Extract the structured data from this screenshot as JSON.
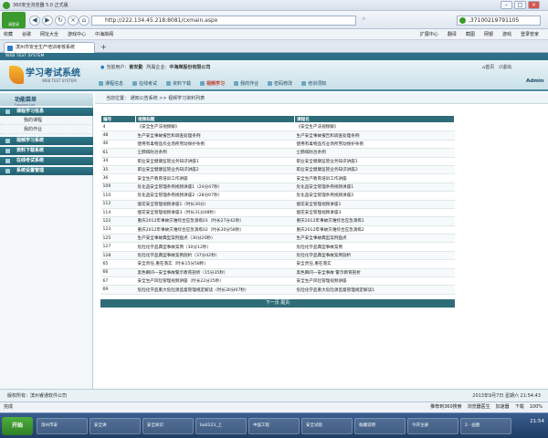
{
  "browser": {
    "window_title": "360安全浏览器 5.0 正式版",
    "logo_label": "请登录",
    "address": "http://222.134.45.218:8081/cxmain.aspx",
    "search_value": ",37100219791105",
    "favorites": [
      "收藏",
      "谷歌",
      "网址大全",
      "游戏中心",
      "中海岸阁"
    ],
    "right_tools": [
      "扩展中心",
      "翻译",
      "截图",
      "网银",
      "游戏",
      "登录管家"
    ],
    "tab_label": "滨州市安全生产培训考核系统",
    "status_left": "完成",
    "status_right": [
      "推荐到360搜索",
      "浏览器医生",
      "加速器",
      "下载",
      "100%"
    ]
  },
  "app": {
    "topbar_text": "WEB TEST SYSTEM",
    "brand_title": "学习考试系统",
    "brand_sub": "WEB TEST SYSTEM",
    "current_user_label": "当前用户：",
    "current_user": "索安勤",
    "company_label": "所属企业：",
    "company": "中海岸股份有限公司",
    "top_links": [
      "首页",
      "退出"
    ],
    "admin": "Admin",
    "menu": [
      "课程信息",
      "在线考试",
      "资料下载",
      "视频学习",
      "我的作业",
      "密码修改",
      "培训须知"
    ],
    "active_menu_index": 3
  },
  "sidebar": {
    "title": "功能菜单",
    "subtitle": "Function List",
    "groups": [
      {
        "label": "课程学习信息",
        "items": [
          "我的课程",
          "我的作业"
        ]
      },
      {
        "label": "视频学习系统",
        "items": []
      },
      {
        "label": "资料下载系统",
        "items": []
      },
      {
        "label": "在线考试系统",
        "items": []
      },
      {
        "label": "系统设置管理",
        "items": []
      }
    ]
  },
  "breadcrumb": "当前位置： 通知公告系统 >> 视频学习资料列表",
  "table": {
    "headers": [
      "编号",
      "视频标题",
      "课程名"
    ],
    "rows": [
      [
        "4",
        "《安全生产法视频解》",
        "《安全生产法视频解》"
      ],
      [
        "48",
        "生产安全事故报告和调查处理条例",
        "生产安全事故报告和调查处理条例"
      ],
      [
        "46",
        "使用有毒物品作业场所劳动保护条例",
        "使用有毒物品作业场所劳动保护条例"
      ],
      [
        "61",
        "尘肺病防治条例",
        "尘肺病防治条例"
      ],
      [
        "34",
        "职业安全健康监管业务知识讲座1",
        "职业安全健康监管业务知识讲座1"
      ],
      [
        "35",
        "职业安全健康监管业务知识讲座2",
        "职业安全健康监管业务知识讲座2"
      ],
      [
        "36",
        "安全生产教育培训工作讲座",
        "安全生产教育培训工作讲座"
      ],
      [
        "109",
        "危化品安全管理条例视频讲座1（24分47秒）",
        "危化品安全管理条例视频讲座1"
      ],
      [
        "110",
        "危化品安全管理条例视频讲座2（28分07秒）",
        "危化品安全管理条例视频讲座2"
      ],
      [
        "112",
        "烟花安全管理视频讲座1（时长30分）",
        "烟花安全管理视频讲座1"
      ],
      [
        "114",
        "烟花安全管理视频讲座3（时长31分08秒）",
        "烟花安全管理视频讲座3"
      ],
      [
        "122",
        "重庆2012年事故灾难综合应急演练01（时长27分42秒）",
        "重庆2012年事故灾难综合应急演练1"
      ],
      [
        "123",
        "重庆2012年事故灾难综合应急演练02（时长30分58秒）",
        "重庆2012年事故灾难综合应急演练2"
      ],
      [
        "125",
        "生产安全事故典型案例盘点（30分20秒）",
        "生产安全事故典型案例盘点"
      ],
      [
        "127",
        "危险化学品典型事故案例（30分12秒）",
        "危险化学品典型事故案例"
      ],
      [
        "128",
        "危险化学品典型事故案例剖析（37分42秒）",
        "危险化学品典型事故案例剖析"
      ],
      [
        "65",
        "安全责任,重在落实（时长15分58秒）",
        "安全责任,重在落实"
      ],
      [
        "66",
        "黑色瞬间一安全事故警示教育剖析（15分35秒）",
        "黑色瞬间一安全事故 警示教育剖析"
      ],
      [
        "67",
        "安全生产风险管理视频讲座（时长22分25秒）",
        "安全生产风险管理视频讲座"
      ],
      [
        "69",
        "危险化学品重大危险源监督管理规定解读（时长30分07秒）",
        "危险化学品重大危险源监督管理规定解读1"
      ]
    ]
  },
  "pager": "下一页 尾页",
  "footer": {
    "copyright": "版权所有：滨州睿通软件公司",
    "datetime": "2013年9月7日 星期六 21:54:43"
  },
  "taskbar": {
    "start": "开始",
    "tasks": [
      "滨州市安",
      "安全讲",
      "安全知识",
      "ba0123_上",
      "中国工程",
      "安全试验",
      "收藏说明",
      "今开注册",
      "2 - 画图"
    ],
    "clock": "21:54"
  }
}
